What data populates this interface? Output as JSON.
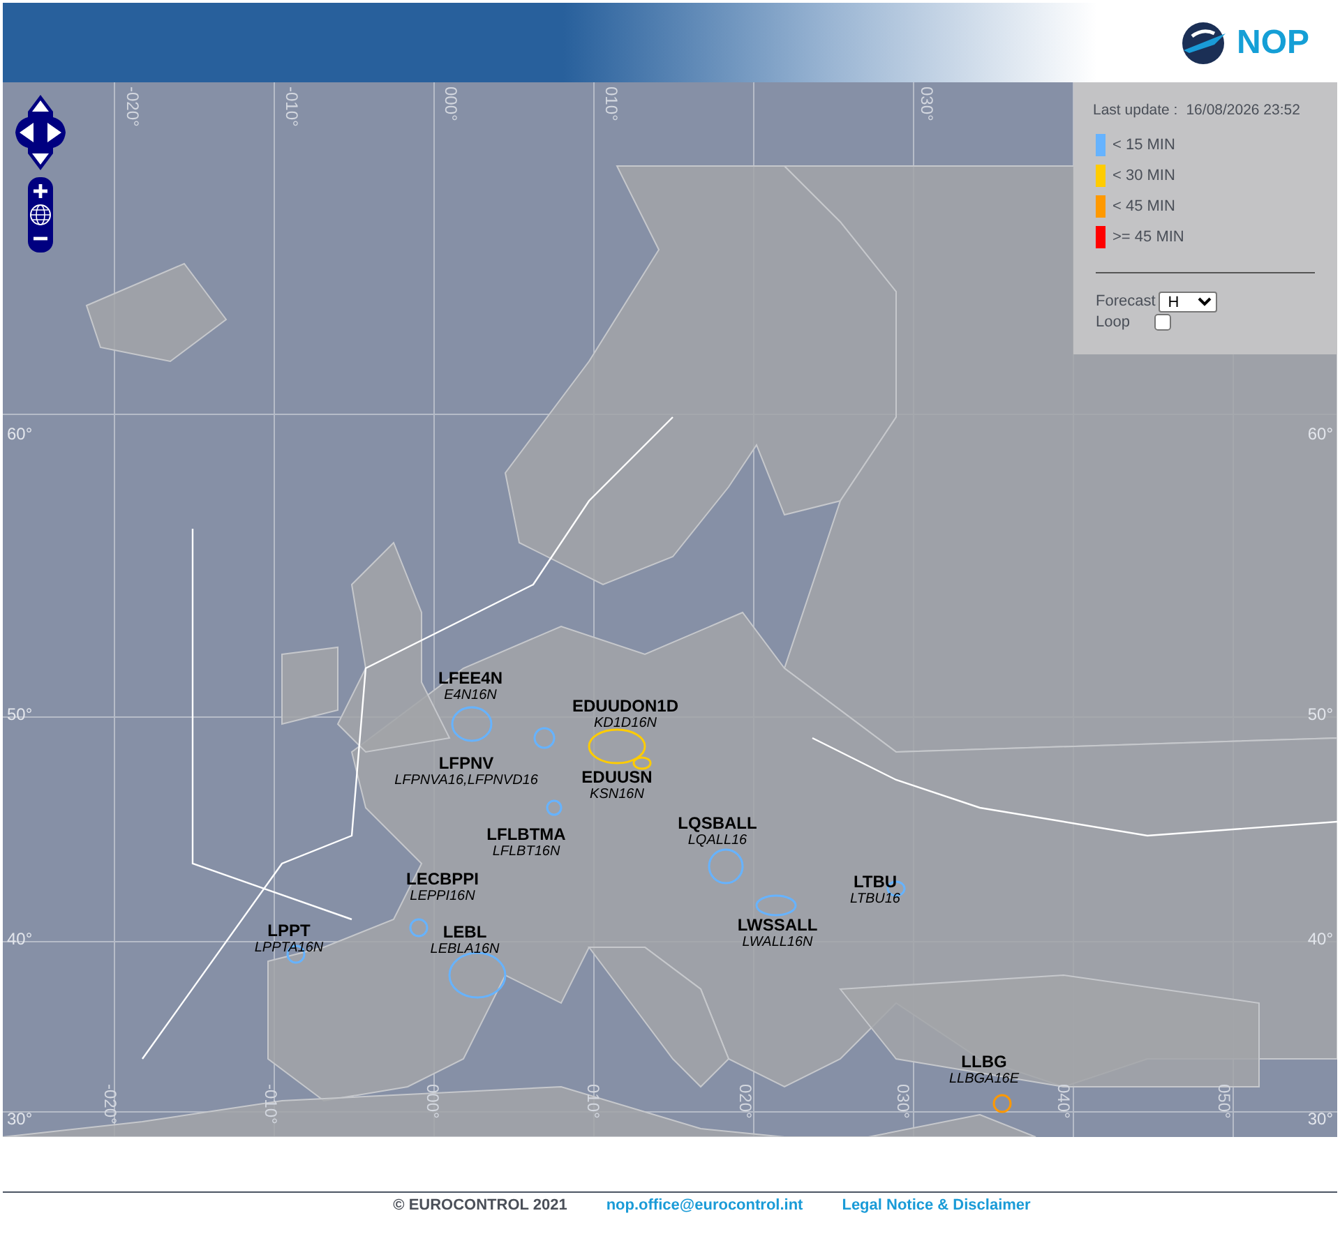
{
  "header": {
    "logo_text": "NOP"
  },
  "map": {
    "lon_labels_top": [
      "-020°",
      "-010°",
      "000°",
      "010°",
      "030°"
    ],
    "lon_labels_bottom": [
      "-020°",
      "-010°",
      "000°",
      "010°",
      "020°",
      "030°",
      "040°",
      "050°"
    ],
    "lat_labels_left": [
      "60°",
      "50°",
      "40°",
      "30°"
    ],
    "lat_labels_right": [
      "60°",
      "50°",
      "40°",
      "30°"
    ],
    "sectors": [
      {
        "name": "LFEE4N",
        "code": "E4N16N",
        "color": "#66b3ff"
      },
      {
        "name": "EDUUDON1D",
        "code": "KD1D16N",
        "color": "#ffcc00"
      },
      {
        "name": "LFPNV",
        "code": "LFPNVA16,LFPNVD16",
        "color": "#66b3ff"
      },
      {
        "name": "EDUUSN",
        "code": "KSN16N",
        "color": "#ffcc00"
      },
      {
        "name": "LQSBALL",
        "code": "LQALL16",
        "color": "#66b3ff"
      },
      {
        "name": "LFLBTMA",
        "code": "LFLBT16N",
        "color": "#66b3ff"
      },
      {
        "name": "LECBPPI",
        "code": "LEPPI16N",
        "color": "#66b3ff"
      },
      {
        "name": "LTBU",
        "code": "LTBU16",
        "color": "#66b3ff"
      },
      {
        "name": "LPPT",
        "code": "LPPTA16N",
        "color": "#66b3ff"
      },
      {
        "name": "LEBL",
        "code": "LEBLA16N",
        "color": "#66b3ff"
      },
      {
        "name": "LWSSALL",
        "code": "LWALL16N",
        "color": "#66b3ff"
      },
      {
        "name": "LLBG",
        "code": "LLBGA16E",
        "color": "#ff9900"
      }
    ]
  },
  "legend": {
    "last_update_label": "Last update :",
    "last_update": "16/08/2026 23:52",
    "items": [
      {
        "label": "< 15 MIN",
        "color": "#66b3ff"
      },
      {
        "label": "< 30 MIN",
        "color": "#ffcc00"
      },
      {
        "label": "< 45 MIN",
        "color": "#ff9900"
      },
      {
        "label": ">= 45 MIN",
        "color": "#ff0000"
      }
    ],
    "forecast": {
      "label": "Forecast",
      "value": "H"
    },
    "loop": {
      "label": "Loop",
      "checked": false
    }
  },
  "footer": {
    "copyright": "© EUROCONTROL 2021",
    "email": "nop.office@eurocontrol.int",
    "legal": "Legal Notice & Disclaimer"
  }
}
